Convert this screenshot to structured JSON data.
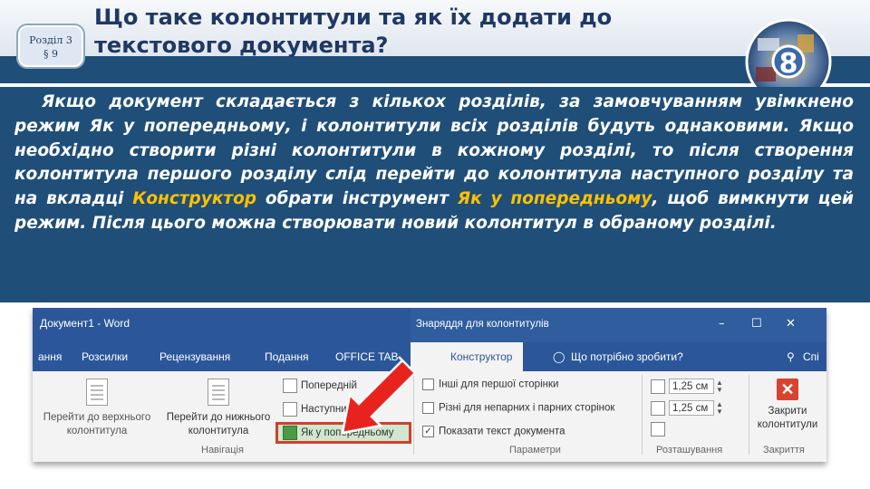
{
  "header": {
    "section_line1": "Розділ 3",
    "section_line2": "§ 9",
    "title": "Що таке колонтитули та як їх додати до текстового документа?",
    "grade_number": "8"
  },
  "paragraph": {
    "part1": "Якщо документ складається з кількох розділів, за замовчуванням увімкнено режим Як у попередньому, і колонтитули всіх розділів будуть однаковими. Якщо необхідно створити різні колонтитули в кожному розділі, то після створення колонтитула першого розділу слід перейти до колонтитула наступного розділу та на вкладці ",
    "highlight1": "Конструктор",
    "part2": " обрати інструмент ",
    "highlight2": "Як у попередньому",
    "part3": ", щоб вимкнути цей режим. Після цього можна створювати новий колонтитул в обраному розділі."
  },
  "colors": {
    "panel_bg": "#1f4e79",
    "highlight": "#ffc000",
    "word_blue": "#2b579a",
    "selection_border": "#d0402a",
    "arrow": "#e8231e"
  },
  "ribbon": {
    "document_title": "Документ1 - Word",
    "context_label": "Знаряддя для колонтитулів",
    "window_controls": [
      "–",
      "☐",
      "✕"
    ],
    "tabs": [
      "ання",
      "Розсилки",
      "Рецензування",
      "Подання",
      "OFFICE TAB",
      "Конструктор"
    ],
    "active_tab": "Конструктор",
    "help_text": "Що потрібно зробити?",
    "share_text": "Спі",
    "navigation": {
      "goto_header": "Перейти до верхнього колонтитула",
      "goto_footer": "Перейти до нижнього колонтитула",
      "previous": "Попередній",
      "next": "Наступний",
      "link_previous": "Як у попередньому",
      "group_label": "Навігація"
    },
    "options": {
      "different_first": "Інші для першої сторінки",
      "different_odd_even": "Різні для непарних і парних сторінок",
      "show_text": "Показати текст документа",
      "show_text_checked": true,
      "group_label": "Параметри"
    },
    "position": {
      "header_value": "1,25 см",
      "footer_value": "1,25 см",
      "group_label": "Розташування"
    },
    "close": {
      "label": "Закрити колонтитули",
      "group_label": "Закриття"
    }
  }
}
